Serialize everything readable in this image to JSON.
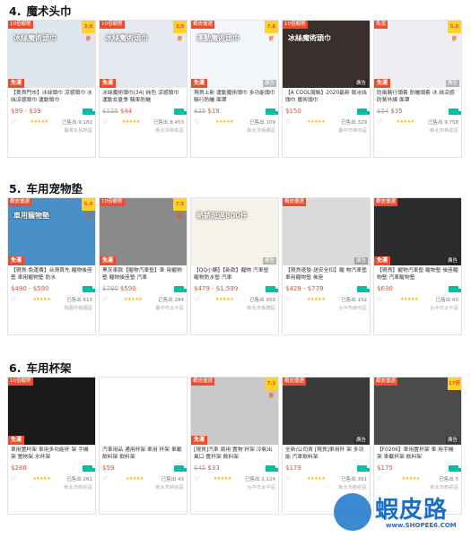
{
  "sections": [
    {
      "number": "4.",
      "title": "魔术头巾",
      "products": [
        {
          "badge": "10倍蝦幣",
          "pct": "3.9折",
          "hero": "冰絲魔術頭巾",
          "sale": "免運",
          "ad": "",
          "title": "【賣貨門市】冰絲頭巾 涼感頭巾 冰絲涼感頭巾 運動頭巾",
          "old_price": "",
          "price": "$99 - $39",
          "sold": "已售出 9,182",
          "location": "臺灣本島地區",
          "bg": "#dfe6ef"
        },
        {
          "badge": "10倍蝦幣",
          "pct": "3.9折",
          "hero": "冰絲魔術頭巾",
          "sale": "免運",
          "ad": "",
          "title": "冰絲魔術頭巾(34) 純色 涼感頭巾 運動女夏季 騎車防曬",
          "old_price": "$125",
          "price": "$44",
          "sold": "已售出 8,453",
          "location": "新北市新莊區",
          "bg": "#e6e9ef"
        },
        {
          "badge": "蝦皮優選",
          "pct": "7.6折",
          "hero": "運動魔術頭巾",
          "sale": "免運",
          "ad": "廣告",
          "title": "現貨上新 運動魔術頭巾 多功能頭巾 騎行防曬 面罩",
          "old_price": "$25",
          "price": "$19",
          "sold": "已售出 109",
          "location": "新北市板橋區",
          "bg": "#f3f6fa"
        },
        {
          "badge": "10倍蝦幣",
          "pct": "",
          "hero": "冰絲魔術頭巾",
          "sale": "",
          "ad": "廣告",
          "title": "【A COOL服裝】2020最新 款冰絲頭巾 魔術頭巾",
          "old_price": "",
          "price": "$150",
          "sold": "已售出 329",
          "location": "臺中市西屯區",
          "bg": "#3b2f2d"
        },
        {
          "badge": "免運",
          "pct": "5.5折",
          "hero": "",
          "sale": "免運",
          "ad": "廣告",
          "title": "防風騎行頭套 防曬頭套 冰 絲涼感 防紫外線 面罩",
          "old_price": "$54",
          "price": "$35",
          "sold": "已售出 9,758",
          "location": "新北市新莊區",
          "bg": "#f0eef4"
        }
      ]
    },
    {
      "number": "5.",
      "title": "车用宠物垫",
      "products": [
        {
          "badge": "蝦皮優選",
          "pct": "5.4折",
          "hero": "車用寵物墊",
          "sale": "免運",
          "ad": "",
          "title": "【現貨-免運費】台灣首先 寵物後座墊 車用寵物墊 防水",
          "old_price": "",
          "price": "$490 - $590",
          "sold": "已售出 613",
          "location": "桃園市桃園區",
          "bg": "#4a90c8"
        },
        {
          "badge": "10倍蝦幣",
          "pct": "7.5折",
          "hero": "",
          "sale": "免運",
          "ad": "",
          "title": "黑灰車款【寵物汽車墊】車 用寵物墊 寵物後座墊 汽車",
          "old_price": "$790",
          "price": "$590",
          "sold": "已售出 284",
          "location": "臺中市太平區",
          "bg": "#8a8a8a"
        },
        {
          "badge": "",
          "pct": "",
          "hero": "熱銷超過800件",
          "sale": "",
          "ad": "廣告",
          "title": "【QQ小舖】【新款】寵物 汽車墊 寵物防水墊 汽車",
          "old_price": "",
          "price": "$479 - $1,599",
          "sold": "已售出 959",
          "location": "新北市板橋區",
          "bg": "#f7f2e8"
        },
        {
          "badge": "蝦皮優選",
          "pct": "",
          "hero": "",
          "sale": "",
          "ad": "廣告",
          "title": "【現貨速發-送安全扣】寵 物汽車墊 車用寵物墊 後座",
          "old_price": "",
          "price": "$429 - $779",
          "sold": "已售出 152",
          "location": "台中市西屯區",
          "bg": "#d9d9d9"
        },
        {
          "badge": "蝦皮優選",
          "pct": "",
          "hero": "",
          "sale": "免運",
          "ad": "廣告",
          "title": "【現貨】寵物汽車墊 寵物墊 後座寵物墊 汽車寵物墊",
          "old_price": "",
          "price": "$630",
          "sold": "已售出 60",
          "location": "台中市太平區",
          "bg": "#2c2c2e"
        }
      ]
    },
    {
      "number": "6.",
      "title": "车用杯架",
      "products": [
        {
          "badge": "10倍蝦幣",
          "pct": "",
          "hero": "",
          "sale": "免運",
          "ad": "",
          "title": "車用置杯架 車用多功能杯 架 手機架 置物架 水杯架",
          "old_price": "",
          "price": "$288",
          "sold": "已售出 261",
          "location": "新北市新莊區",
          "bg": "#1a1a1a"
        },
        {
          "badge": "",
          "pct": "",
          "hero": "",
          "sale": "",
          "ad": "",
          "title": "汽車用品 通用杯架 車用 杯架 車載飲料架 飲料架",
          "old_price": "",
          "price": "$59",
          "sold": "已售出 43",
          "location": "新北市新莊區",
          "bg": "#ffffff"
        },
        {
          "badge": "蝦皮優選",
          "pct": "7.3折",
          "hero": "",
          "sale": "免運",
          "ad": "",
          "title": "[現貨]汽車 兩用 置物 杯架 冷氣出風口 置杯架 飲料架",
          "old_price": "$45",
          "price": "$33",
          "sold": "已售出 2,124",
          "location": "台中市太平區",
          "bg": "#c9c9c9"
        },
        {
          "badge": "蝦皮優選",
          "pct": "",
          "hero": "",
          "sale": "",
          "ad": "廣告",
          "title": "全新/公司貨 [現貨]車用杯 架 多功能 汽車飲料架",
          "old_price": "",
          "price": "$179",
          "sold": "已售出 391",
          "location": "新北市新莊區",
          "bg": "#3a3a3a"
        },
        {
          "badge": "蝦皮優選",
          "pct": "17折",
          "hero": "",
          "sale": "",
          "ad": "廣告",
          "title": "【F0206】車用置杯架 車 用手機架 車載杯架 飲料架",
          "old_price": "",
          "price": "$175",
          "sold": "已售出 5",
          "location": "新北市新莊區",
          "bg": "#4b4b4b"
        }
      ]
    }
  ],
  "watermark": {
    "text": "蝦皮路",
    "url": "www.SHOPEE6.COM"
  },
  "colors": {
    "accent": "#ee4d2d",
    "badge_yellow": "#ffd31f",
    "shipping": "#00bfa5",
    "star": "#ffb400"
  }
}
